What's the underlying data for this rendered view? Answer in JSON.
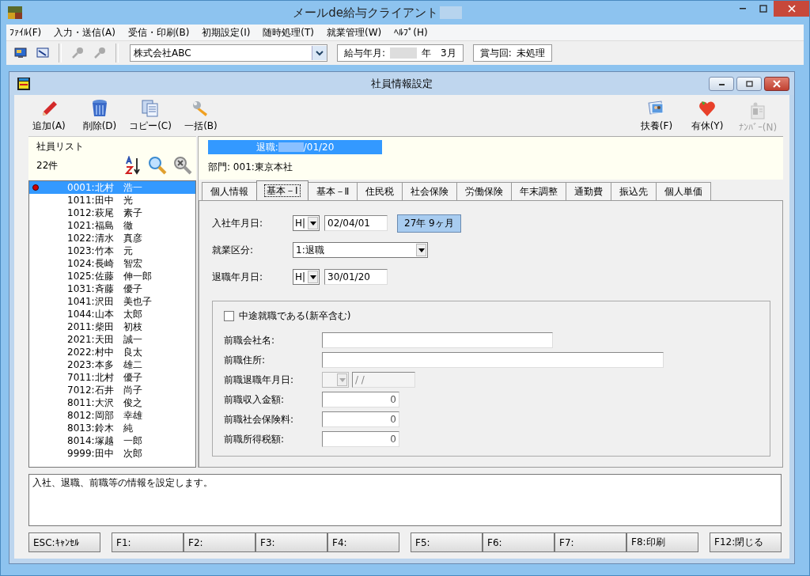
{
  "app_window": {
    "title": "メールde給与クライアント"
  },
  "menu": [
    "ﾌｧｲﾙ(F)",
    "入力・送信(A)",
    "受信・印刷(B)",
    "初期設定(I)",
    "随時処理(T)",
    "就業管理(W)",
    "ﾍﾙﾌﾟ(H)"
  ],
  "company": {
    "value": "株式会社ABC"
  },
  "pay_month": {
    "label": "給与年月:",
    "value": "年　3月"
  },
  "bonus": {
    "label": "賞与回:",
    "value": "未処理"
  },
  "child_window": {
    "title": "社員情報設定"
  },
  "toolbar_left": [
    {
      "label": "追加(A)",
      "disabled": false
    },
    {
      "label": "削除(D)",
      "disabled": false
    },
    {
      "label": "コピー(C)",
      "disabled": false
    },
    {
      "label": "一括(B)",
      "disabled": false
    }
  ],
  "toolbar_right": [
    {
      "label": "扶養(F)",
      "disabled": false
    },
    {
      "label": "有休(Y)",
      "disabled": false
    },
    {
      "label": "ﾅﾝﾊﾞｰ(N)",
      "disabled": true
    }
  ],
  "employee_list": {
    "title": "社員リスト",
    "count": "22件",
    "items": [
      {
        "text": "0001:北村　浩一",
        "selected": true,
        "flagged": true
      },
      {
        "text": "1011:田中　光",
        "selected": false,
        "flagged": false
      },
      {
        "text": "1012:萩尾　素子",
        "selected": false,
        "flagged": false
      },
      {
        "text": "1021:福島　徹",
        "selected": false,
        "flagged": false
      },
      {
        "text": "1022:清水　真彦",
        "selected": false,
        "flagged": false
      },
      {
        "text": "1023:竹本　元",
        "selected": false,
        "flagged": false
      },
      {
        "text": "1024:長崎　智宏",
        "selected": false,
        "flagged": false
      },
      {
        "text": "1025:佐藤　伸一郎",
        "selected": false,
        "flagged": false
      },
      {
        "text": "1031:斉藤　優子",
        "selected": false,
        "flagged": false
      },
      {
        "text": "1041:沢田　美也子",
        "selected": false,
        "flagged": false
      },
      {
        "text": "1044:山本　太郎",
        "selected": false,
        "flagged": false
      },
      {
        "text": "2011:柴田　初枝",
        "selected": false,
        "flagged": false
      },
      {
        "text": "2021:天田　誠一",
        "selected": false,
        "flagged": false
      },
      {
        "text": "2022:村中　良太",
        "selected": false,
        "flagged": false
      },
      {
        "text": "2023:本多　雄二",
        "selected": false,
        "flagged": false
      },
      {
        "text": "7011:北村　優子",
        "selected": false,
        "flagged": false
      },
      {
        "text": "7012:石井　尚子",
        "selected": false,
        "flagged": false
      },
      {
        "text": "8011:大沢　俊之",
        "selected": false,
        "flagged": false
      },
      {
        "text": "8012:岡部　幸雄",
        "selected": false,
        "flagged": false
      },
      {
        "text": "8013:鈴木　純",
        "selected": false,
        "flagged": false
      },
      {
        "text": "8014:塚越　一郎",
        "selected": false,
        "flagged": false
      },
      {
        "text": "9999:田中　次郎",
        "selected": false,
        "flagged": false
      }
    ]
  },
  "status_banner": {
    "label": "退職:",
    "date": "/01/20"
  },
  "department": "部門: 001:東京本社",
  "tabs": [
    {
      "label": "個人情報",
      "selected": false
    },
    {
      "label": "基本－Ⅰ",
      "selected": true
    },
    {
      "label": "基本－Ⅱ",
      "selected": false
    },
    {
      "label": "住民税",
      "selected": false
    },
    {
      "label": "社会保険",
      "selected": false
    },
    {
      "label": "労働保険",
      "selected": false
    },
    {
      "label": "年末調整",
      "selected": false
    },
    {
      "label": "通勤費",
      "selected": false
    },
    {
      "label": "振込先",
      "selected": false
    },
    {
      "label": "個人単価",
      "selected": false
    }
  ],
  "hire_date": {
    "label": "入社年月日:",
    "era": "H|",
    "value": "02/04/01",
    "tenure": "27年 9ヶ月"
  },
  "employment_type": {
    "label": "就業区分:",
    "value": "1:退職"
  },
  "retire_date": {
    "label": "退職年月日:",
    "era": "H|",
    "value": "30/01/20"
  },
  "previous_job": {
    "checkbox": {
      "label": "中途就職である(新卒含む)",
      "checked": false
    },
    "fields": [
      {
        "kind": "text",
        "label": "前職会社名:"
      },
      {
        "kind": "long_text",
        "label": "前職住所:"
      },
      {
        "kind": "date",
        "label": "前職退職年月日:",
        "value": "/ /"
      },
      {
        "kind": "amount",
        "label": "前職収入金額:",
        "value": "0"
      },
      {
        "kind": "amount",
        "label": "前職社会保険料:",
        "value": "0"
      },
      {
        "kind": "amount",
        "label": "前職所得税額:",
        "value": "0"
      }
    ]
  },
  "message": "入社、退職、前職等の情報を設定します。",
  "function_key_groups": [
    [
      "ESC:ｷｬﾝｾﾙ"
    ],
    [
      "F1:",
      "F2:",
      "F3:",
      "F4:"
    ],
    [
      "F5:",
      "F6:",
      "F7:",
      "F8:印刷"
    ],
    [
      "F12:閉じる"
    ]
  ]
}
